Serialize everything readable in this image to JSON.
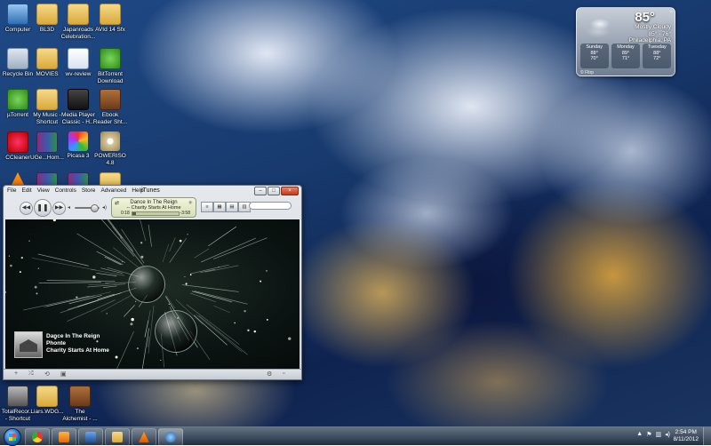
{
  "desktop_icons": {
    "computer": "Computer",
    "folder_1": "BL3D",
    "japanroads": "Japanroads Celebration...",
    "avid": "AVId 14 Sfx",
    "recycle": "Recycle Bin",
    "folder_2": "MOVIES",
    "wordvision": "wv-review",
    "bittorrent": "BitTorrent Download",
    "utorrent": "µTorrent",
    "music_shortcut": "My Music - Shortcut",
    "mediaplayer": "Media Player Classic - H...",
    "ebook": "Ebook Reader Sht...",
    "ccleaner": "CCleaner",
    "winrar_1": "UGe...Hom...",
    "picasa": "Picasa 3",
    "poweriso": "POWERISO 4.8",
    "vlc": "",
    "winrar_2": "",
    "winrar_3": "",
    "folder_3": "",
    "totalrecorder": "TotalRecor... - Shortcut",
    "liars": "Liars.WDG...",
    "alchemist": "The Alchemist - ..."
  },
  "weather": {
    "temp": "85°",
    "condition": "Mostly Cloudy",
    "range": "85° - 76°",
    "location": "Philadelphia, PA",
    "source": "© Fltrp",
    "days": [
      {
        "name": "Sunday",
        "hi": "88°",
        "lo": "70°"
      },
      {
        "name": "Monday",
        "hi": "89°",
        "lo": "71°"
      },
      {
        "name": "Tuesday",
        "hi": "88°",
        "lo": "72°"
      }
    ]
  },
  "itunes": {
    "title": "iTunes",
    "menu": [
      "File",
      "Edit",
      "View",
      "Controls",
      "Store",
      "Advanced",
      "Help"
    ],
    "now_playing": {
      "song": "Dance In The Reign",
      "artist": "-- Charity Starts At Home",
      "elapsed": "0:18",
      "remaining": "-3:58",
      "progress": 0.07
    },
    "artwork_info": {
      "song": "Dance In The Reign",
      "artist": "Phonte",
      "album": "Charity Starts At Home"
    },
    "search_placeholder": "",
    "volume": 0.75
  },
  "taskbar": {
    "time": "2:54 PM",
    "date": "8/11/2012"
  }
}
